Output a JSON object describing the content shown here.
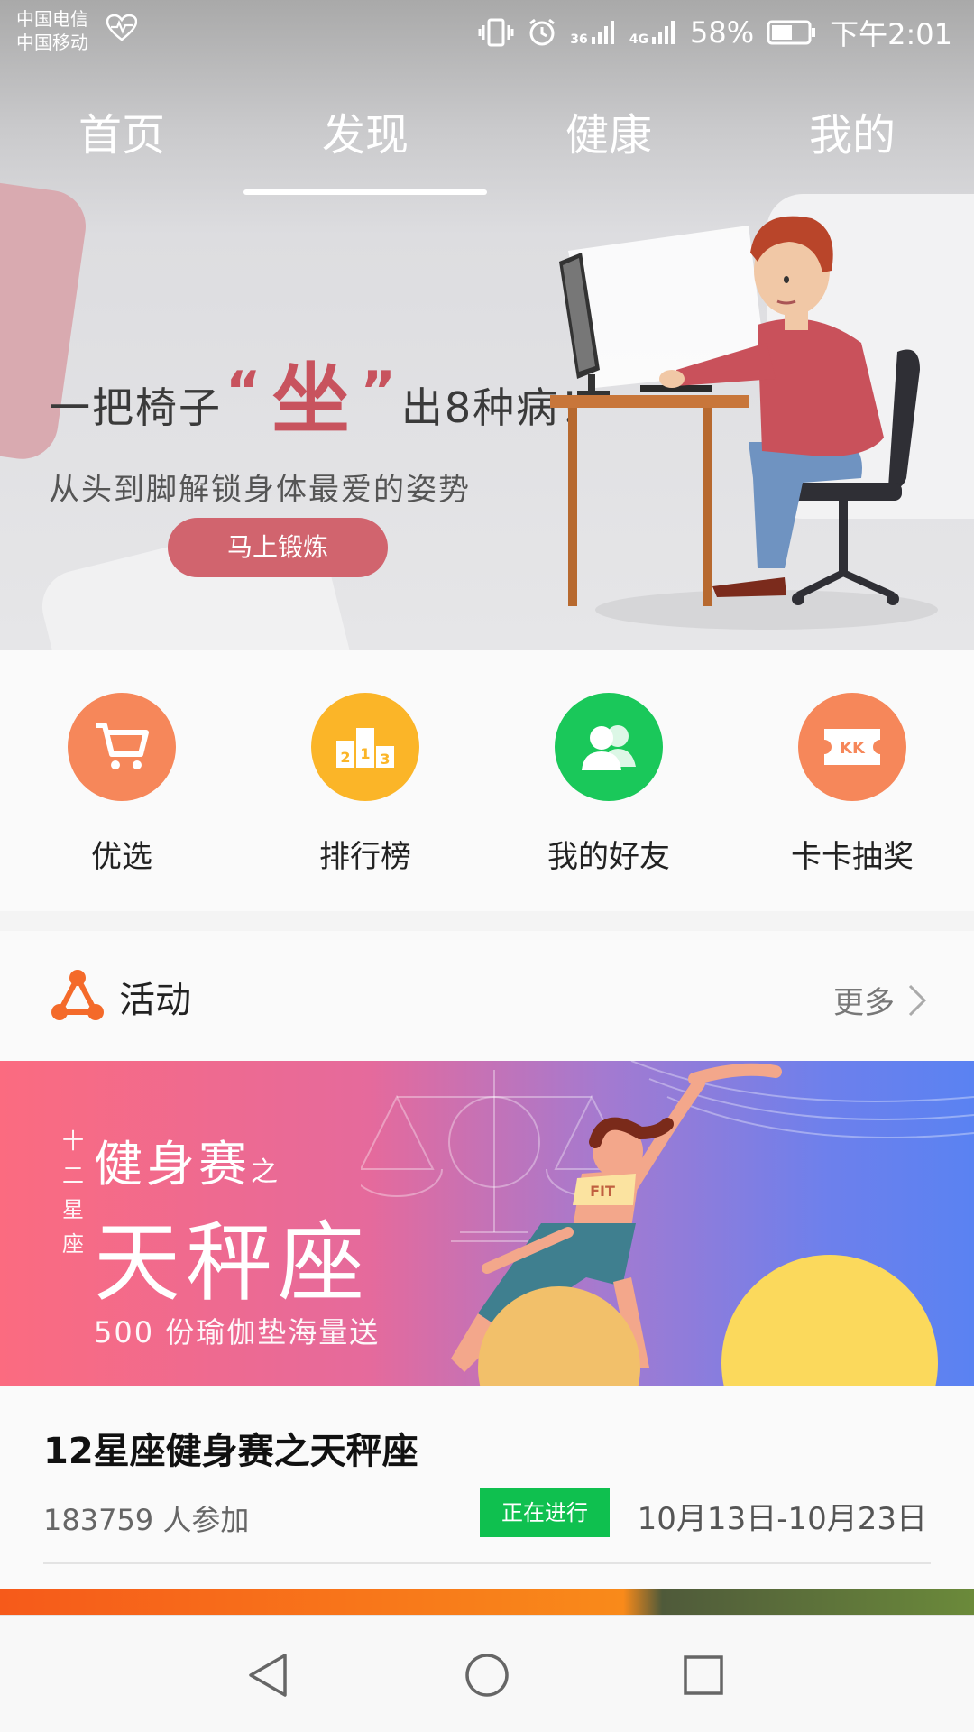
{
  "status_bar": {
    "carrier_1": "中国电信",
    "carrier_2": "中国移动",
    "network_1": "36",
    "network_2": "4G",
    "battery": "58%",
    "time": "下午2:01"
  },
  "tabs": [
    {
      "label": "首页",
      "active": false
    },
    {
      "label": "发现",
      "active": true
    },
    {
      "label": "健康",
      "active": false
    },
    {
      "label": "我的",
      "active": false
    }
  ],
  "hero": {
    "headline_pre": "一把椅子",
    "quote_open": "“",
    "headline_big": "坐",
    "quote_close": "”",
    "headline_post": "出8种病！",
    "subline": "从头到脚解锁身体最爱的姿势",
    "cta": "马上锻炼"
  },
  "quick_actions": [
    {
      "label": "优选",
      "icon": "cart-icon",
      "color": "#f6875a"
    },
    {
      "label": "排行榜",
      "icon": "podium-icon",
      "color": "#fbb528",
      "podium": [
        "2",
        "1",
        "3"
      ]
    },
    {
      "label": "我的好友",
      "icon": "friends-icon",
      "color": "#1ac85a"
    },
    {
      "label": "卡卡抽奖",
      "icon": "ticket-icon",
      "color": "#f6875a",
      "ticket_text": "KK"
    }
  ],
  "activity": {
    "title": "活动",
    "more": "更多",
    "banner": {
      "side_text": [
        "十",
        "二",
        "星",
        "座"
      ],
      "line1": "健身赛",
      "line1_suffix": "之",
      "line2": "天秤座",
      "line3": "500 份瑜伽垫海量送",
      "shirt_text": "FIT"
    },
    "event_title": "12星座健身赛之天秤座",
    "participants": "183759 人参加",
    "status": "正在进行",
    "dates": "10月13日-10月23日"
  },
  "colors": {
    "accent_red": "#c8535e",
    "status_green": "#0fc04f"
  }
}
